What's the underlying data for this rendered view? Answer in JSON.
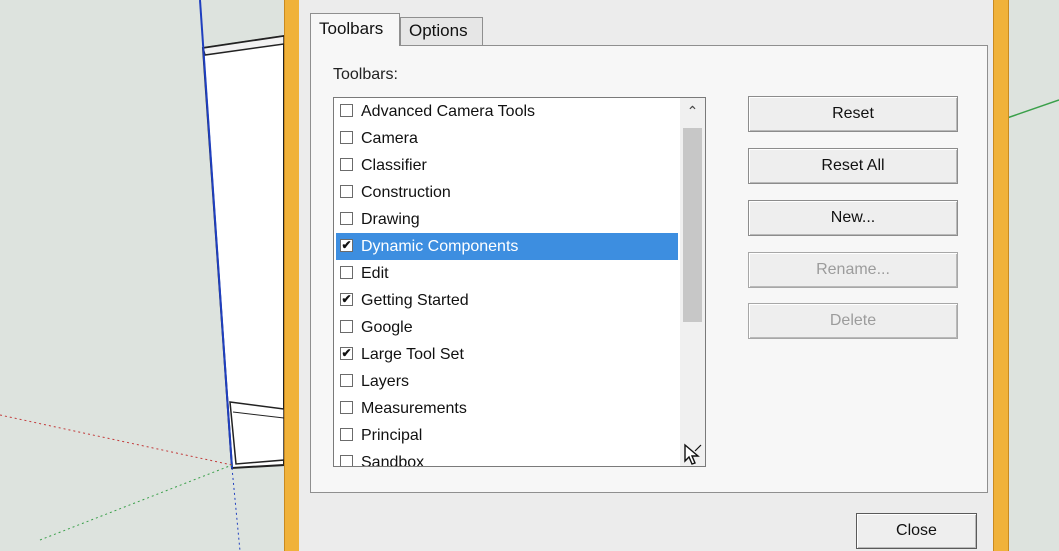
{
  "tabs": [
    {
      "label": "Toolbars",
      "active": true
    },
    {
      "label": "Options",
      "active": false
    }
  ],
  "group_label": "Toolbars:",
  "toolbar_list": [
    {
      "label": "Advanced Camera Tools",
      "checked": false,
      "selected": false
    },
    {
      "label": "Camera",
      "checked": false,
      "selected": false
    },
    {
      "label": "Classifier",
      "checked": false,
      "selected": false
    },
    {
      "label": "Construction",
      "checked": false,
      "selected": false
    },
    {
      "label": "Drawing",
      "checked": false,
      "selected": false
    },
    {
      "label": "Dynamic Components",
      "checked": true,
      "selected": true
    },
    {
      "label": "Edit",
      "checked": false,
      "selected": false
    },
    {
      "label": "Getting Started",
      "checked": true,
      "selected": false
    },
    {
      "label": "Google",
      "checked": false,
      "selected": false
    },
    {
      "label": "Large Tool Set",
      "checked": true,
      "selected": false
    },
    {
      "label": "Layers",
      "checked": false,
      "selected": false
    },
    {
      "label": "Measurements",
      "checked": false,
      "selected": false
    },
    {
      "label": "Principal",
      "checked": false,
      "selected": false
    },
    {
      "label": "Sandbox",
      "checked": false,
      "selected": false
    }
  ],
  "buttons": {
    "reset": "Reset",
    "reset_all": "Reset All",
    "new": "New...",
    "rename": "Rename...",
    "delete": "Delete",
    "close": "Close"
  },
  "icons": {
    "scroll_up": "chevron-up-icon",
    "cursor": "mouse-pointer-icon",
    "checkmark": "checkmark-icon"
  },
  "colors": {
    "selection": "#3d8ee0",
    "dialog_frame": "#f0b23a",
    "viewport_bg": "#dde3de"
  }
}
